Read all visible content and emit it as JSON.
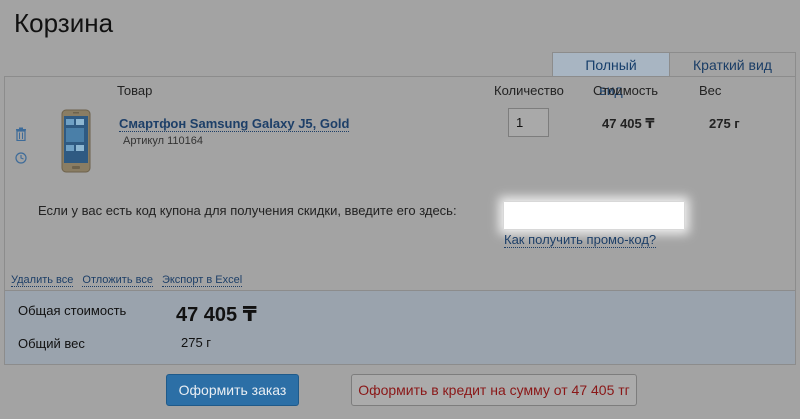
{
  "page": {
    "title": "Корзина"
  },
  "tabs": [
    {
      "label": "Полный вид",
      "active": true
    },
    {
      "label": "Краткий вид",
      "active": false
    }
  ],
  "table": {
    "headers": {
      "product": "Товар",
      "quantity": "Количество",
      "cost": "Стоимость",
      "weight": "Вес"
    }
  },
  "item": {
    "name": "Смартфон Samsung Galaxy J5, Gold",
    "sku": "Артикул 110164",
    "quantity": "1",
    "price": "47 405 ₸",
    "weight": "275 г"
  },
  "coupon": {
    "prompt": "Если у вас есть код купона для получения скидки, введите его здесь:",
    "value": "",
    "promo_link": "Как получить промо-код?"
  },
  "actions": {
    "delete_all": "Удалить все",
    "postpone_all": "Отложить все",
    "export_excel": "Экспорт в Excel"
  },
  "summary": {
    "total_label": "Общая стоимость",
    "total_value": "47 405 ₸",
    "weight_label": "Общий вес",
    "weight_value": "275 г"
  },
  "buttons": {
    "order": "Оформить заказ",
    "credit": "Оформить в кредит на сумму от 47 405 тг"
  },
  "colors": {
    "link": "#1d3f68",
    "primary_button": "#2c6fa6",
    "credit_text": "#8a1717"
  },
  "icons": [
    "trash-icon",
    "clock-icon"
  ]
}
